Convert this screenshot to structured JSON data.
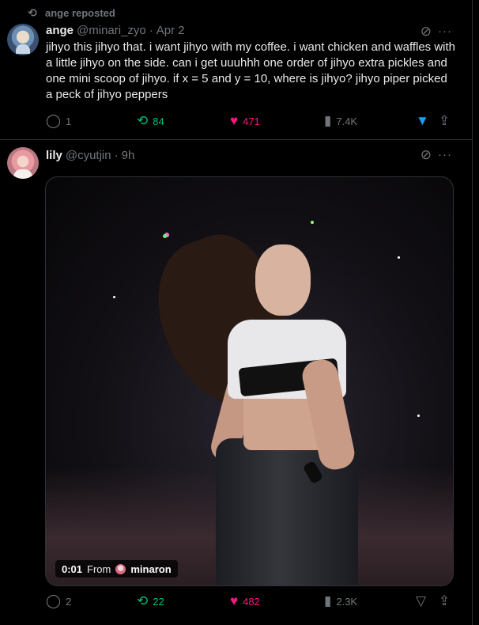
{
  "tweet1": {
    "repost_label": "ange reposted",
    "name": "ange",
    "handle": "@minari_zyo",
    "sep": "·",
    "time": "Apr 2",
    "text": "jihyo this jihyo that. i want jihyo with my coffee. i want chicken and waffles with a little jihyo on the side. can i get uuuhhh one order of jihyo extra pickles and one mini scoop of jihyo. if x = 5 and y = 10, where is jihyo? jihyo piper picked a peck of jihyo peppers",
    "replies": "1",
    "reposts": "84",
    "likes": "471",
    "views": "7.4K",
    "more": "···"
  },
  "tweet2": {
    "name": "lily",
    "handle": "@cyutjin",
    "sep": "·",
    "time": "9h",
    "video": {
      "time": "0:01",
      "from_label": "From",
      "source": "minaron"
    },
    "replies": "2",
    "reposts": "22",
    "likes": "482",
    "views": "2.3K",
    "more": "···"
  },
  "icons": {
    "repost": "repost-icon",
    "reply": "reply-icon",
    "like": "heart-icon",
    "views": "views-icon",
    "bookmark": "bookmark-icon",
    "share": "share-icon",
    "grok": "grok-icon"
  },
  "colors": {
    "repost": "#00ba7c",
    "like": "#f91880",
    "bookmark": "#1d9bf0",
    "muted": "#71767b"
  }
}
